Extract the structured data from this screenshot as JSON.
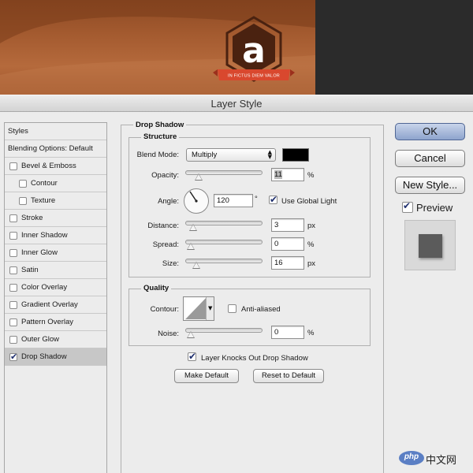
{
  "canvas": {
    "logo_letter": "a",
    "ribbon_text": "IN FICTUS DIEM VALOR"
  },
  "dialog": {
    "title": "Layer Style"
  },
  "styles_list": {
    "header": "Styles",
    "blending_options": "Blending Options: Default",
    "items": [
      {
        "label": "Bevel & Emboss",
        "checked": false,
        "indent": false,
        "selected": false
      },
      {
        "label": "Contour",
        "checked": false,
        "indent": true,
        "selected": false
      },
      {
        "label": "Texture",
        "checked": false,
        "indent": true,
        "selected": false
      },
      {
        "label": "Stroke",
        "checked": false,
        "indent": false,
        "selected": false
      },
      {
        "label": "Inner Shadow",
        "checked": false,
        "indent": false,
        "selected": false
      },
      {
        "label": "Inner Glow",
        "checked": false,
        "indent": false,
        "selected": false
      },
      {
        "label": "Satin",
        "checked": false,
        "indent": false,
        "selected": false
      },
      {
        "label": "Color Overlay",
        "checked": false,
        "indent": false,
        "selected": false
      },
      {
        "label": "Gradient Overlay",
        "checked": false,
        "indent": false,
        "selected": false
      },
      {
        "label": "Pattern Overlay",
        "checked": false,
        "indent": false,
        "selected": false
      },
      {
        "label": "Outer Glow",
        "checked": false,
        "indent": false,
        "selected": false
      },
      {
        "label": "Drop Shadow",
        "checked": true,
        "indent": false,
        "selected": true
      }
    ]
  },
  "drop_shadow": {
    "title": "Drop Shadow",
    "structure": {
      "title": "Structure",
      "blend_mode_label": "Blend Mode:",
      "blend_mode_value": "Multiply",
      "shadow_color": "#000000",
      "opacity_label": "Opacity:",
      "opacity_value": "11",
      "opacity_unit": "%",
      "opacity_fraction": 0.11,
      "angle_label": "Angle:",
      "angle_value": "120",
      "angle_unit": "°",
      "use_global_light_label": "Use Global Light",
      "use_global_light": true,
      "distance_label": "Distance:",
      "distance_value": "3",
      "distance_unit": "px",
      "distance_fraction": 0.03,
      "spread_label": "Spread:",
      "spread_value": "0",
      "spread_unit": "%",
      "spread_fraction": 0.0,
      "size_label": "Size:",
      "size_value": "16",
      "size_unit": "px",
      "size_fraction": 0.08
    },
    "quality": {
      "title": "Quality",
      "contour_label": "Contour:",
      "anti_aliased_label": "Anti-aliased",
      "anti_aliased": false,
      "noise_label": "Noise:",
      "noise_value": "0",
      "noise_unit": "%",
      "noise_fraction": 0.0
    },
    "knockout_label": "Layer Knocks Out Drop Shadow",
    "knockout": true,
    "make_default_label": "Make Default",
    "reset_default_label": "Reset to Default"
  },
  "buttons": {
    "ok": "OK",
    "cancel": "Cancel",
    "new_style": "New Style...",
    "preview_label": "Preview",
    "preview_checked": true
  },
  "watermark": {
    "badge": "php",
    "text": "中文网"
  }
}
